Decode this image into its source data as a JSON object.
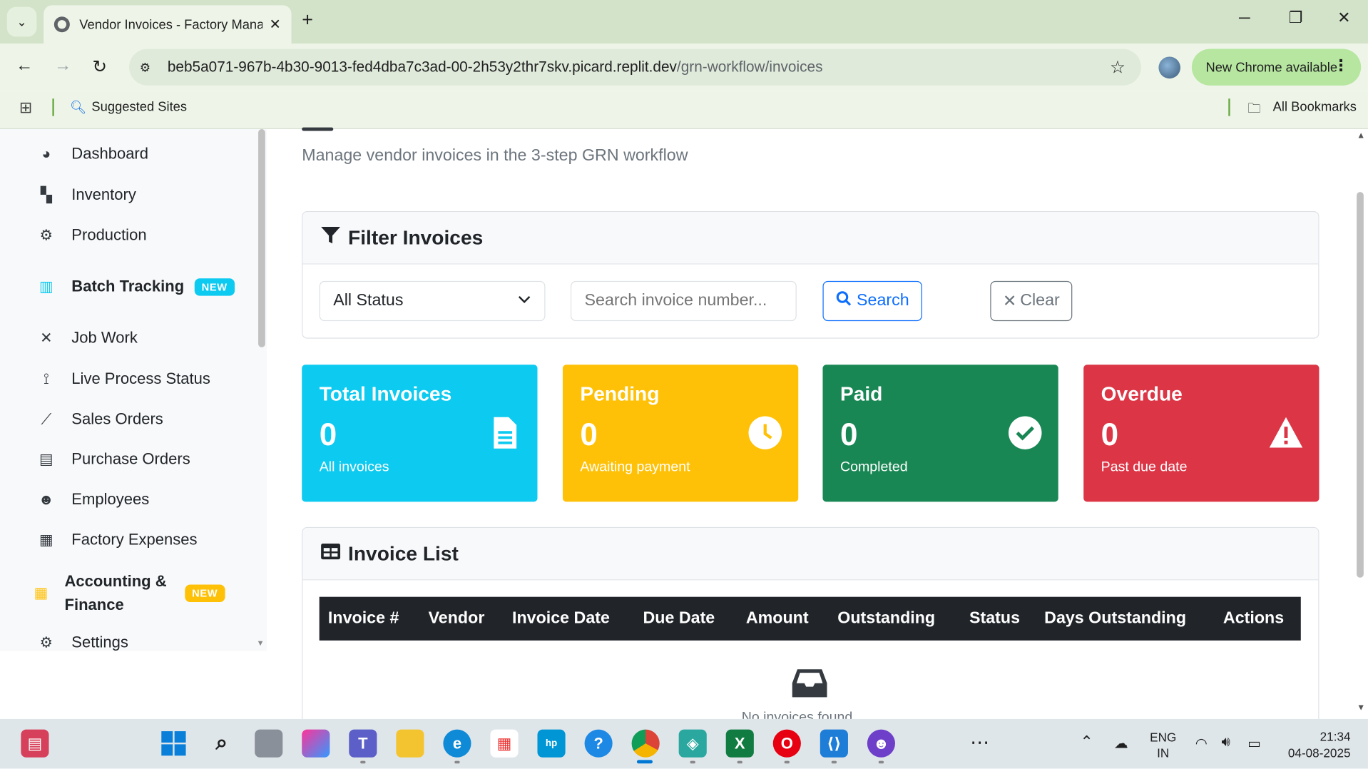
{
  "browser": {
    "tab_title": "Vendor Invoices - Factory Mana",
    "url_host": "beb5a071-967b-4b30-9013-fed4dba7c3ad-00-2h53y2thr7skv.picard.replit.dev",
    "url_path": "/grn-workflow/invoices",
    "new_chrome": "New Chrome available",
    "bookmark_suggested": "Suggested Sites",
    "bookmark_all": "All Bookmarks"
  },
  "sidebar": {
    "items": [
      {
        "label": "Dashboard",
        "icon": "palette-icon"
      },
      {
        "label": "Inventory",
        "icon": "boxes-icon"
      },
      {
        "label": "Production",
        "icon": "gears-icon"
      },
      {
        "label": "Batch Tracking",
        "icon": "barcode-icon",
        "badge": "NEW"
      },
      {
        "label": "Job Work",
        "icon": "tools-icon"
      },
      {
        "label": "Live Process Status",
        "icon": "broadcast-icon"
      },
      {
        "label": "Sales Orders",
        "icon": "chart-line-icon"
      },
      {
        "label": "Purchase Orders",
        "icon": "file-invoice-icon"
      },
      {
        "label": "Employees",
        "icon": "users-icon"
      },
      {
        "label": "Factory Expenses",
        "icon": "receipt-icon"
      },
      {
        "label": "Accounting &",
        "label2": "Finance",
        "icon": "calculator-icon",
        "badge": "NEW"
      },
      {
        "label": "Settings",
        "icon": "cog-icon"
      }
    ]
  },
  "page": {
    "subtitle": "Manage vendor invoices in the 3-step GRN workflow"
  },
  "filter": {
    "title": "Filter Invoices",
    "status_selected": "All Status",
    "search_placeholder": "Search invoice number...",
    "search_label": "Search",
    "clear_label": "Clear"
  },
  "stats": [
    {
      "title": "Total Invoices",
      "value": "0",
      "sub": "All invoices",
      "color": "#0dcaf0",
      "icon": "file-icon"
    },
    {
      "title": "Pending",
      "value": "0",
      "sub": "Awaiting payment",
      "color": "#ffc107",
      "icon": "clock-icon"
    },
    {
      "title": "Paid",
      "value": "0",
      "sub": "Completed",
      "color": "#198754",
      "icon": "check-circle-icon"
    },
    {
      "title": "Overdue",
      "value": "0",
      "sub": "Past due date",
      "color": "#dc3545",
      "icon": "warning-icon"
    }
  ],
  "invoice_list": {
    "title": "Invoice List",
    "columns": [
      "Invoice #",
      "Vendor",
      "Invoice Date",
      "Due Date",
      "Amount",
      "Outstanding",
      "Status",
      "Days Outstanding",
      "Actions"
    ],
    "empty_text": "No invoices found"
  },
  "taskbar": {
    "lang": "ENG",
    "region": "IN",
    "time": "21:34",
    "date": "04-08-2025"
  }
}
